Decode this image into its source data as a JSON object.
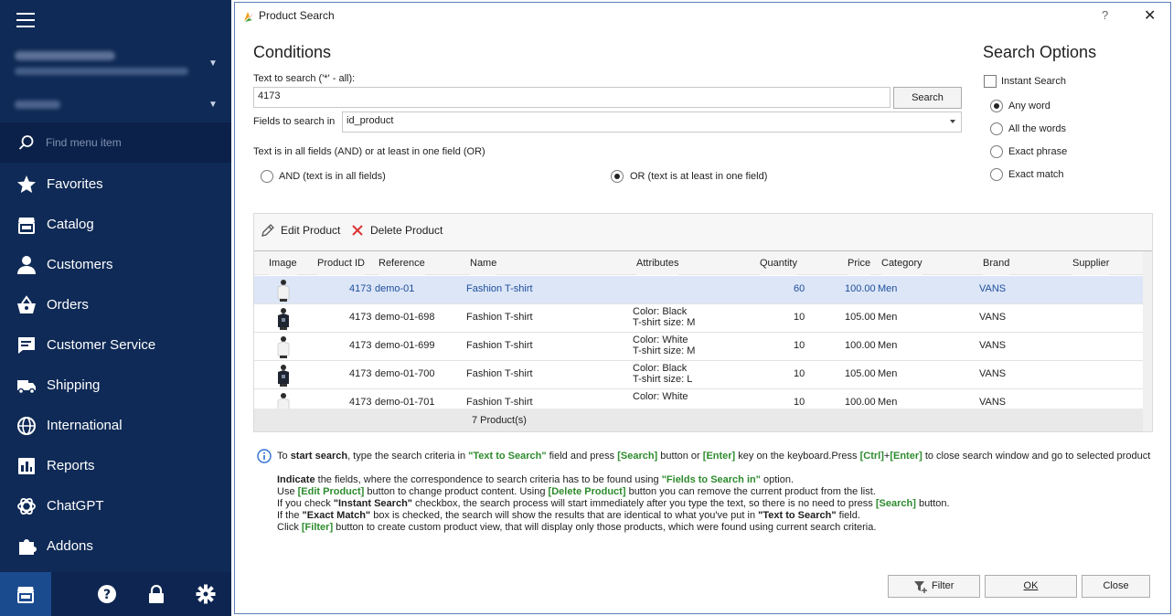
{
  "sidebar": {
    "search_placeholder": "Find menu item",
    "items": [
      {
        "label": "Favorites",
        "icon": "star-icon"
      },
      {
        "label": "Catalog",
        "icon": "catalog-icon"
      },
      {
        "label": "Customers",
        "icon": "user-icon"
      },
      {
        "label": "Orders",
        "icon": "basket-icon"
      },
      {
        "label": "Customer Service",
        "icon": "chat-icon"
      },
      {
        "label": "Shipping",
        "icon": "truck-icon"
      },
      {
        "label": "International",
        "icon": "globe-icon"
      },
      {
        "label": "Reports",
        "icon": "reports-icon"
      },
      {
        "label": "ChatGPT",
        "icon": "chatgpt-icon"
      },
      {
        "label": "Addons",
        "icon": "puzzle-icon"
      }
    ]
  },
  "dialog": {
    "title": "Product Search",
    "help": "?",
    "close": "✕",
    "conditions_heading": "Conditions",
    "text_label": "Text to search ('*' - all):",
    "text_value": "4173",
    "search_button": "Search",
    "fields_label": "Fields to search in",
    "fields_value": "id_product",
    "logic_label": "Text is in all fields (AND) or at least in one field (OR)",
    "and_label": "AND (text is in all fields)",
    "or_label": "OR (text is at least in one field)",
    "options_heading": "Search Options",
    "instant_label": "Instant Search",
    "options": [
      "Any word",
      "All the words",
      "Exact phrase",
      "Exact match"
    ]
  },
  "toolbar": {
    "edit": "Edit Product",
    "delete": "Delete Product"
  },
  "table": {
    "columns": [
      "Image",
      "Product ID",
      "Reference",
      "Name",
      "Attributes",
      "Quantity",
      "Price",
      "Category",
      "Brand",
      "Supplier"
    ],
    "rows": [
      {
        "id": "4173",
        "ref": "demo-01",
        "name": "Fashion T-shirt",
        "attr1": "",
        "attr2": "",
        "qty": "60",
        "price": "100.00",
        "cat": "Men",
        "brand": "VANS",
        "supplier": ""
      },
      {
        "id": "4173",
        "ref": "demo-01-698",
        "name": "Fashion T-shirt",
        "attr1": "Color: Black",
        "attr2": "T-shirt size: M",
        "qty": "10",
        "price": "105.00",
        "cat": "Men",
        "brand": "VANS",
        "supplier": ""
      },
      {
        "id": "4173",
        "ref": "demo-01-699",
        "name": "Fashion T-shirt",
        "attr1": "Color: White",
        "attr2": "T-shirt size: M",
        "qty": "10",
        "price": "100.00",
        "cat": "Men",
        "brand": "VANS",
        "supplier": ""
      },
      {
        "id": "4173",
        "ref": "demo-01-700",
        "name": "Fashion T-shirt",
        "attr1": "Color: Black",
        "attr2": "T-shirt size: L",
        "qty": "10",
        "price": "105.00",
        "cat": "Men",
        "brand": "VANS",
        "supplier": ""
      },
      {
        "id": "4173",
        "ref": "demo-01-701",
        "name": "Fashion T-shirt",
        "attr1": "Color: White",
        "attr2": "",
        "qty": "10",
        "price": "100.00",
        "cat": "Men",
        "brand": "VANS",
        "supplier": ""
      }
    ],
    "footer": "7 Product(s)"
  },
  "info": {
    "l1a": "To ",
    "l1b": "start search",
    "l1c": ", type the search criteria in ",
    "l1d": "\"Text to Search\"",
    "l1e": " field and press ",
    "l1f": "[Search]",
    "l1g": " button or ",
    "l1h": "[Enter]",
    "l1i": " key on the keyboard.Press ",
    "l1j": "[Ctrl]",
    "l1k": "+",
    "l1l": "[Enter]",
    "l1m": " to close search window and go to selected product",
    "l2a": "Indicate",
    "l2b": " the fields, where the correspondence to search criteria has to be found using ",
    "l2c": "\"Fields to Search in\"",
    "l2d": " option.",
    "l3a": "Use ",
    "l3b": "[Edit Product]",
    "l3c": " button to change product content. Using ",
    "l3d": "[Delete Product]",
    "l3e": " button you can remove the current product from the list.",
    "l4a": "If you check ",
    "l4b": "\"Instant Search\"",
    "l4c": " checkbox, the search process will start immediately after you type the text, so there is no need to press ",
    "l4d": "[Search]",
    "l4e": " button.",
    "l5a": "If the ",
    "l5b": "\"Exact Match\"",
    "l5c": " box is checked, the search will show the results that are identical to what you've put in ",
    "l5d": "\"Text to Search\"",
    "l5e": " field.",
    "l6a": "Click ",
    "l6b": "[Filter]",
    "l6c": " button to create custom product view, that will display only those products, which were found using current search criteria."
  },
  "buttons": {
    "filter": "Filter",
    "ok": "OK",
    "close": "Close"
  }
}
